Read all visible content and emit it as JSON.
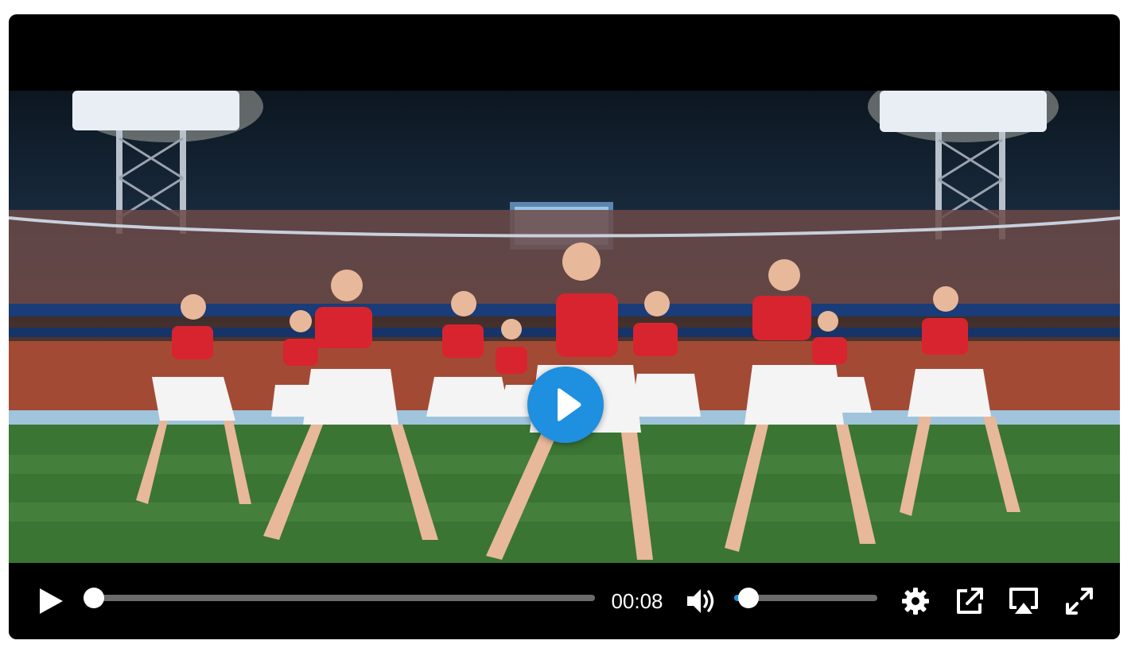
{
  "player": {
    "current_time": "00:08",
    "progress": 0.0,
    "volume": 0.1,
    "accent_color": "#1f8fe0"
  },
  "icons": {
    "play": "play-icon",
    "big_play": "big-play-icon",
    "volume": "volume-icon",
    "settings": "gear-icon",
    "popout": "external-link-icon",
    "airplay": "airplay-icon",
    "fullscreen": "fullscreen-icon"
  }
}
